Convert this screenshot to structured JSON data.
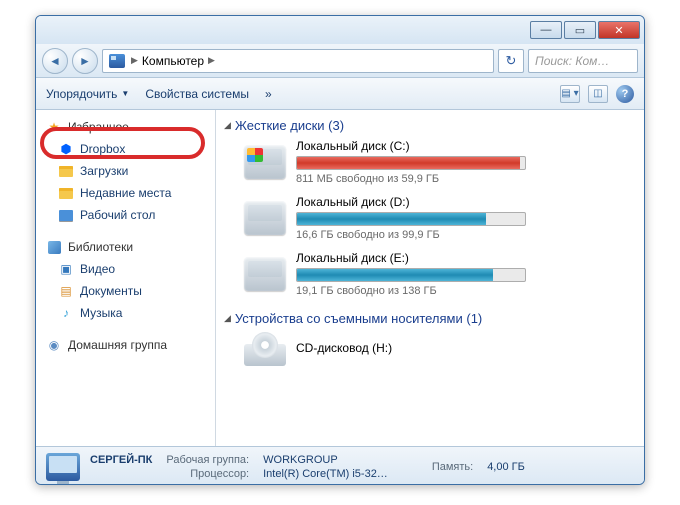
{
  "window": {
    "address": {
      "root": "Компьютер"
    },
    "search_placeholder": "Поиск: Ком…"
  },
  "toolbar": {
    "organize": "Упорядочить",
    "sysprops": "Свойства системы",
    "more": "»"
  },
  "sidebar": {
    "favorites": "Избранное",
    "dropbox": "Dropbox",
    "downloads": "Загрузки",
    "recent": "Недавние места",
    "desktop": "Рабочий стол",
    "libraries": "Библиотеки",
    "video": "Видео",
    "documents": "Документы",
    "music": "Музыка",
    "homegroup": "Домашняя группа"
  },
  "content": {
    "hdd_header": "Жесткие диски (3)",
    "removable_header": "Устройства со съемными носителями (1)",
    "drives": [
      {
        "name": "Локальный диск (C:)",
        "sub": "811 МБ свободно из 59,9 ГБ",
        "fill": 98,
        "color": "red",
        "os": true
      },
      {
        "name": "Локальный диск (D:)",
        "sub": "16,6 ГБ свободно из 99,9 ГБ",
        "fill": 83,
        "color": "blue",
        "os": false
      },
      {
        "name": "Локальный диск (E:)",
        "sub": "19,1 ГБ свободно из 138 ГБ",
        "fill": 86,
        "color": "blue",
        "os": false
      }
    ],
    "cd": {
      "name": "CD-дисковод (H:)"
    }
  },
  "status": {
    "computer_name": "СЕРГЕЙ-ПК",
    "workgroup_label": "Рабочая группа:",
    "workgroup_value": "WORKGROUP",
    "memory_label": "Память:",
    "memory_value": "4,00 ГБ",
    "cpu_label": "Процессор:",
    "cpu_value": "Intel(R) Core(TM) i5-32…"
  }
}
